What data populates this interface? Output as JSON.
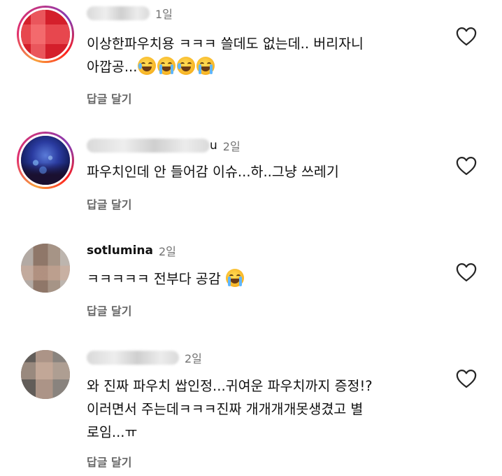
{
  "comments": [
    {
      "username": "",
      "time": "1일",
      "text": "이상한파우치용 ㅋㅋㅋ 쓸데도 없는데.. 버리자니\n아깝공...",
      "reply_label": "답글 달기"
    },
    {
      "username": "",
      "username_tail": "u",
      "time": "2일",
      "text": "파우치인데 안 들어감 이슈...하..그냥 쓰레기",
      "reply_label": "답글 달기"
    },
    {
      "username": "sotlumina",
      "time": "2일",
      "text": "ㅋㅋㅋㅋㅋ 전부다 공감",
      "reply_label": "답글 달기"
    },
    {
      "username": "",
      "time": "2일",
      "text": "와 진짜 파우치 쌉인정...귀여운 파우치까지 증정!?\n이러면서 주는데ㅋㅋㅋ진짜 개개개개못생겼고 별\n로임...ㅠ",
      "reply_label": "답글 달기"
    }
  ],
  "icons": {
    "like": "heart-outline-icon",
    "emoji_laugh_sweat": "grinning-face-with-sweat-emoji",
    "emoji_cry": "loudly-crying-face-emoji",
    "emoji_tears_of_joy": "face-with-tears-of-joy-emoji"
  },
  "colors": {
    "text": "#111111",
    "secondary": "#737373",
    "reply": "#666666",
    "story_ring_start": "#f9a13b",
    "story_ring_mid": "#e1306c",
    "story_ring_end": "#833ab4"
  }
}
